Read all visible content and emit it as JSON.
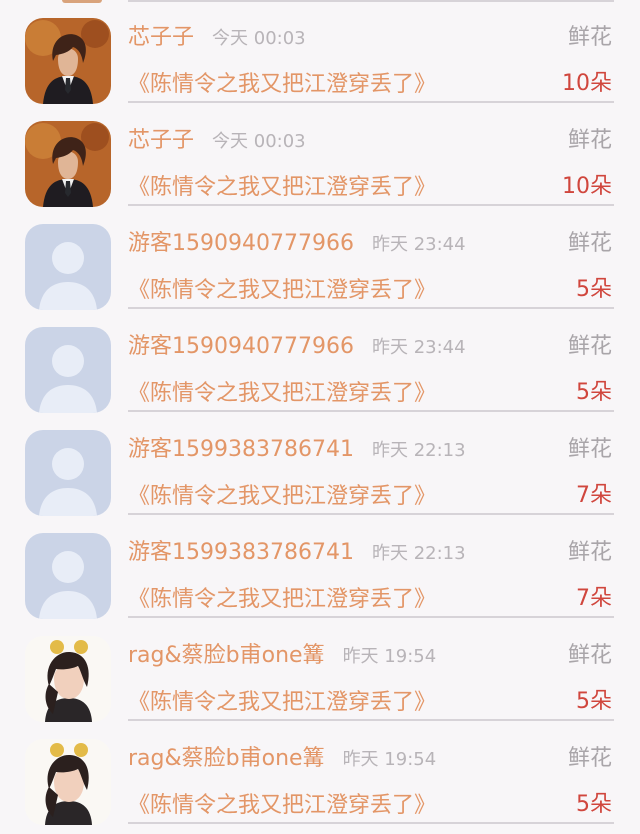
{
  "rows": [
    {
      "avatar": "anime-man-avatar",
      "name": "芯子子",
      "time": "今天 00:03",
      "gift": "鲜花",
      "book": "《陈情令之我又把江澄穿丢了》",
      "count": "10朵"
    },
    {
      "avatar": "anime-man-avatar",
      "name": "芯子子",
      "time": "今天 00:03",
      "gift": "鲜花",
      "book": "《陈情令之我又把江澄穿丢了》",
      "count": "10朵"
    },
    {
      "avatar": "default-user-avatar",
      "name": "游客1590940777966",
      "time": "昨天 23:44",
      "gift": "鲜花",
      "book": "《陈情令之我又把江澄穿丢了》",
      "count": "5朵"
    },
    {
      "avatar": "default-user-avatar",
      "name": "游客1590940777966",
      "time": "昨天 23:44",
      "gift": "鲜花",
      "book": "《陈情令之我又把江澄穿丢了》",
      "count": "5朵"
    },
    {
      "avatar": "default-user-avatar",
      "name": "游客1599383786741",
      "time": "昨天 22:13",
      "gift": "鲜花",
      "book": "《陈情令之我又把江澄穿丢了》",
      "count": "7朵"
    },
    {
      "avatar": "default-user-avatar",
      "name": "游客1599383786741",
      "time": "昨天 22:13",
      "gift": "鲜花",
      "book": "《陈情令之我又把江澄穿丢了》",
      "count": "7朵"
    },
    {
      "avatar": "girl-avatar",
      "name": "rag&蔡脸b甫one篝",
      "time": "昨天 19:54",
      "gift": "鲜花",
      "book": "《陈情令之我又把江澄穿丢了》",
      "count": "5朵"
    },
    {
      "avatar": "girl-avatar",
      "name": "rag&蔡脸b甫one篝",
      "time": "昨天 19:54",
      "gift": "鲜花",
      "book": "《陈情令之我又把江澄穿丢了》",
      "count": "5朵"
    }
  ],
  "colors": {
    "name": "#e39667",
    "time": "#b8b4b8",
    "gift": "#a9a5a9",
    "count": "#d0463d",
    "divider": "#d7d3d8",
    "background": "#f8f6f8"
  }
}
